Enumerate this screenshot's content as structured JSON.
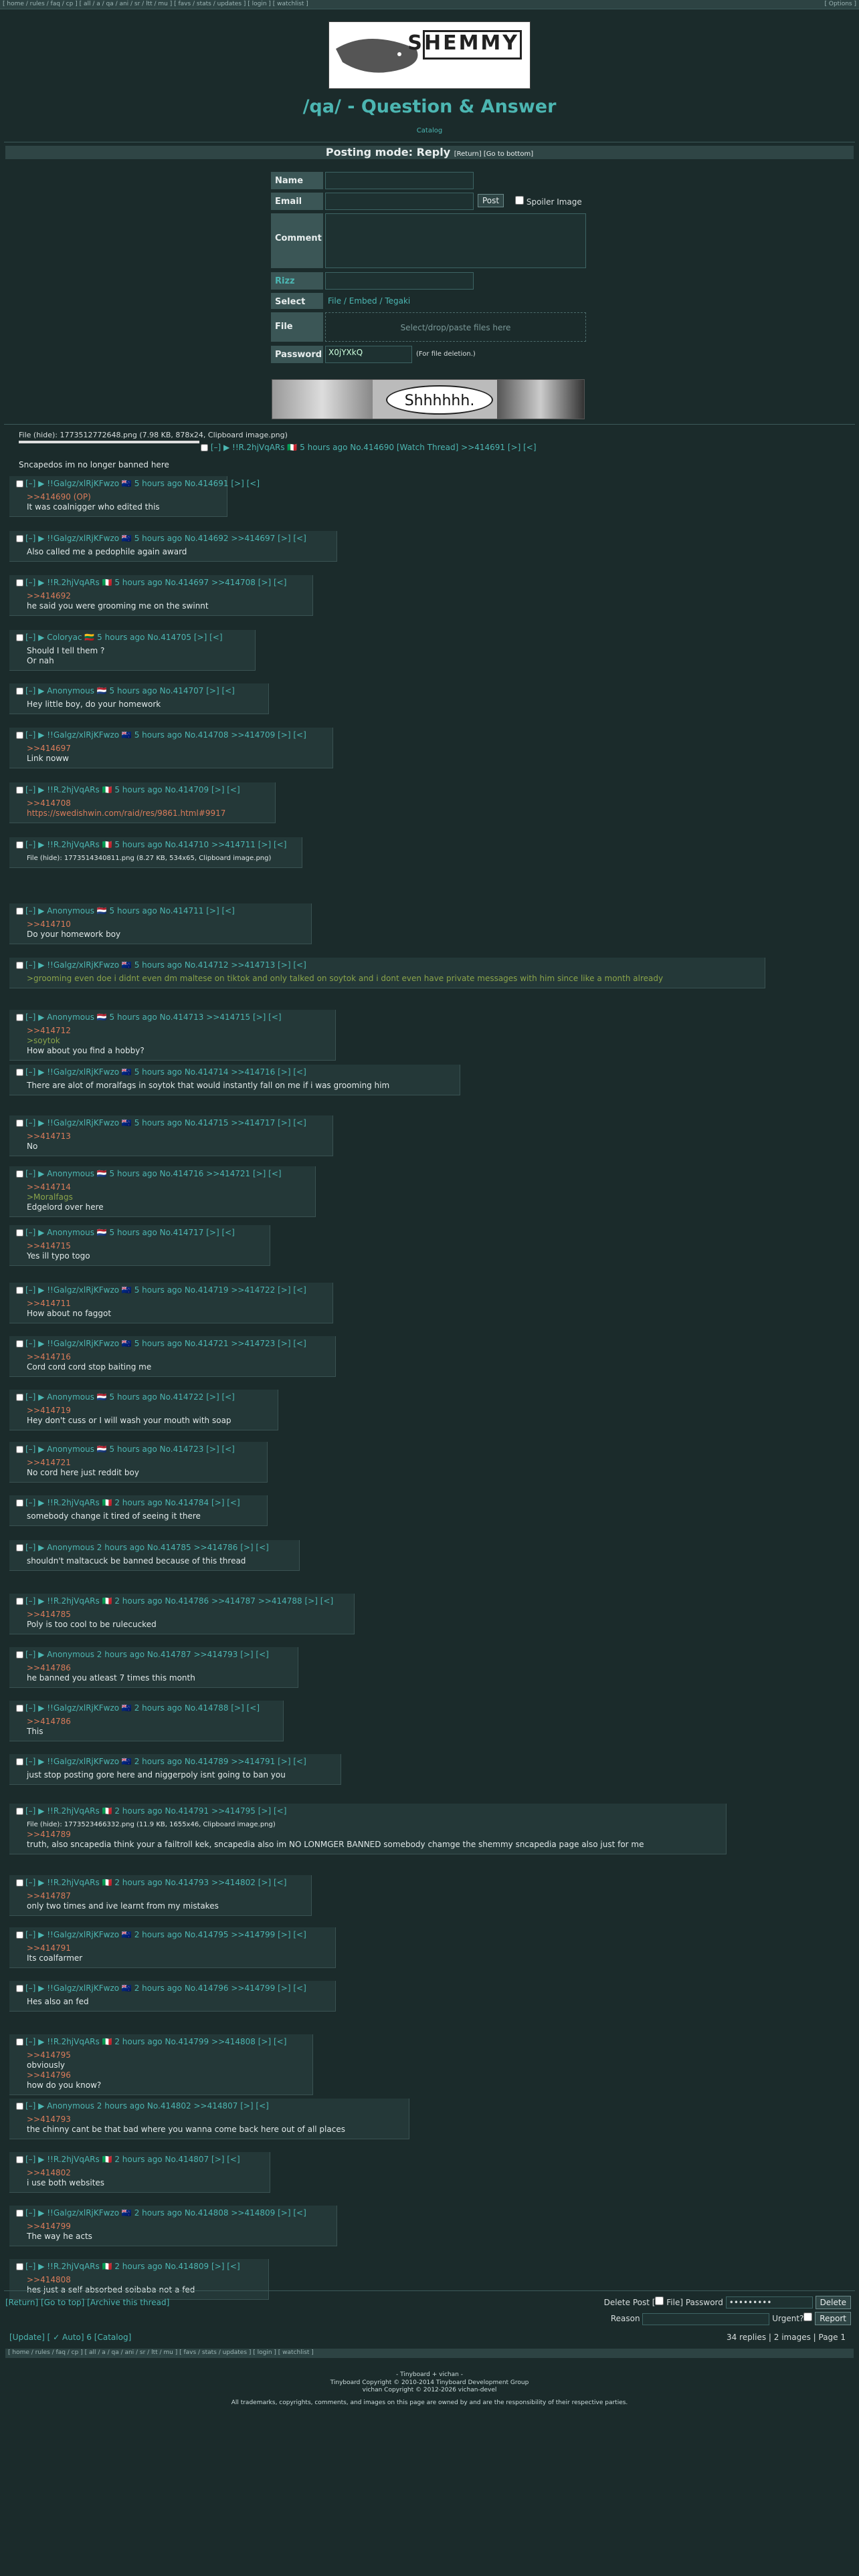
{
  "nav": {
    "left": "[ home / rules / faq / cp ] [ all / a / qa / ani / sr / ltt / mu ] [ favs / stats / updates ] [ login ] [ watchlist ]",
    "right": "[ Options ]"
  },
  "logo": {
    "text": "SHEMMY"
  },
  "board": {
    "title": "/qa/ - Question & Answer",
    "catalog": "Catalog"
  },
  "mode": {
    "label": "Posting mode: Reply",
    "links": "[Return] [Go to bottom]"
  },
  "form": {
    "name": "Name",
    "email": "Email",
    "post": "Post",
    "spoiler": "Spoiler Image",
    "comment": "Comment",
    "rizz": "Rizz",
    "select": "Select",
    "select_opts": "File / Embed / Tegaki",
    "file": "File",
    "drop": "Select/drop/paste files here",
    "password": "Password",
    "pw_val": "X0jYXkQ",
    "pw_note": "(For file deletion.)"
  },
  "banner": {
    "text": "Shhhhhh."
  },
  "op": {
    "file": "File (hide): 1773512772648.png (7.98 KB, 878x24, Clipboard image.png)",
    "head": "[–] ▶ !!R.2hjVqARs 🇮🇹 5 hours ago No.414690 [Watch Thread] >>414691 [>] [<]",
    "body": "Sncapedos im no longer banned here"
  },
  "posts": [
    {
      "h": "[–] ▶ !!Galgz/xlRjKFwzo 🇳🇿 5 hours ago No.414691 [>] [<]",
      "b": [
        ">>414690 (OP)",
        "It was coalnigger who edited this"
      ]
    },
    {
      "h": "[–] ▶ !!Galgz/xlRjKFwzo 🇳🇿 5 hours ago No.414692 >>414697 [>] [<]",
      "b": [
        "Also called me a pedophile again award"
      ]
    },
    {
      "h": "[–] ▶ !!R.2hjVqARs 🇮🇹 5 hours ago No.414697 >>414708 [>] [<]",
      "b": [
        ">>414692",
        "he said you were grooming me on the swinnt"
      ]
    },
    {
      "h": "[–] ▶ Coloryac 🇱🇹 5 hours ago No.414705 [>] [<]",
      "b": [
        "Should I tell them ?",
        "Or nah"
      ]
    },
    {
      "h": "[–] ▶ Anonymous 🇳🇱 5 hours ago No.414707 [>] [<]",
      "b": [
        "Hey little boy, do your homework"
      ]
    },
    {
      "h": "[–] ▶ !!Galgz/xlRjKFwzo 🇳🇿 5 hours ago No.414708 >>414709 [>] [<]",
      "b": [
        ">>414697",
        "Link noww"
      ]
    },
    {
      "h": "[–] ▶ !!R.2hjVqARs 🇮🇹 5 hours ago No.414709 [>] [<]",
      "b": [
        ">>414708",
        "https://swedishwin.com/raid/res/9861.html#9917"
      ]
    },
    {
      "h": "[–] ▶ !!R.2hjVqARs 🇮🇹 5 hours ago No.414710 >>414711 [>] [<]",
      "b": [
        "File (hide): 1773514340811.png (8.27 KB, 534x65, Clipboard image.png)"
      ]
    },
    {
      "h": "[–] ▶ Anonymous 🇳🇱 5 hours ago No.414711 [>] [<]",
      "b": [
        ">>414710",
        "Do your homework boy"
      ]
    },
    {
      "h": "[–] ▶ !!Galgz/xlRjKFwzo 🇳🇿 5 hours ago No.414712 >>414713 [>] [<]",
      "b": [
        ">grooming even doe i didnt even dm maltese on tiktok and only talked on soytok and i dont even have private messages with him since like a month already"
      ]
    },
    {
      "h": "[–] ▶ Anonymous 🇳🇱 5 hours ago No.414713 >>414715 [>] [<]",
      "b": [
        ">>414712",
        ">soytok",
        "How about you find a hobby?"
      ]
    },
    {
      "h": "[–] ▶ !!Galgz/xlRjKFwzo 🇳🇿 5 hours ago No.414714 >>414716 [>] [<]",
      "b": [
        "There are alot of moralfags in soytok that would instantly fall on me if i was grooming him"
      ]
    },
    {
      "h": "[–] ▶ !!Galgz/xlRjKFwzo 🇳🇿 5 hours ago No.414715 >>414717 [>] [<]",
      "b": [
        ">>414713",
        "No"
      ]
    },
    {
      "h": "[–] ▶ Anonymous 🇳🇱 5 hours ago No.414716 >>414721 [>] [<]",
      "b": [
        ">>414714",
        ">Moralfags",
        "Edgelord over here"
      ]
    },
    {
      "h": "[–] ▶ Anonymous 🇳🇱 5 hours ago No.414717 [>] [<]",
      "b": [
        ">>414715",
        "Yes ill typo togo"
      ]
    },
    {
      "h": "[–] ▶ !!Galgz/xlRjKFwzo 🇳🇿 5 hours ago No.414719 >>414722 [>] [<]",
      "b": [
        ">>414711",
        "How about no faggot"
      ]
    },
    {
      "h": "[–] ▶ !!Galgz/xlRjKFwzo 🇳🇿 5 hours ago No.414721 >>414723 [>] [<]",
      "b": [
        ">>414716",
        "Cord cord cord stop baiting me"
      ]
    },
    {
      "h": "[–] ▶ Anonymous 🇳🇱 5 hours ago No.414722 [>] [<]",
      "b": [
        ">>414719",
        "Hey don't cuss or I will wash your mouth with soap"
      ]
    },
    {
      "h": "[–] ▶ Anonymous 🇳🇱 5 hours ago No.414723 [>] [<]",
      "b": [
        ">>414721",
        "No cord here just reddit boy"
      ]
    },
    {
      "h": "[–] ▶ !!R.2hjVqARs 🇮🇹 2 hours ago No.414784 [>] [<]",
      "b": [
        "somebody change it tired of seeing it there"
      ]
    },
    {
      "h": "[–] ▶ Anonymous 2 hours ago No.414785 >>414786 [>] [<]",
      "b": [
        "shouldn't maltacuck be banned because of this thread"
      ]
    },
    {
      "h": "[–] ▶ !!R.2hjVqARs 🇮🇹 2 hours ago No.414786 >>414787 >>414788 [>] [<]",
      "b": [
        ">>414785",
        "Poly is too cool to be rulecucked"
      ]
    },
    {
      "h": "[–] ▶ Anonymous 2 hours ago No.414787 >>414793 [>] [<]",
      "b": [
        ">>414786",
        "he banned you atleast 7 times this month"
      ]
    },
    {
      "h": "[–] ▶ !!Galgz/xlRjKFwzo 🇳🇿 2 hours ago No.414788 [>] [<]",
      "b": [
        ">>414786",
        "This"
      ]
    },
    {
      "h": "[–] ▶ !!Galgz/xlRjKFwzo 🇳🇿 2 hours ago No.414789 >>414791 [>] [<]",
      "b": [
        "just stop posting gore here and niggerpoly isnt going to ban you"
      ]
    },
    {
      "h": "[–] ▶ !!R.2hjVqARs 🇮🇹 2 hours ago No.414791 >>414795 [>] [<]",
      "b": [
        "File (hide): 1773523466332.png (11.9 KB, 1655x46, Clipboard image.png)",
        ">>414789",
        "truth, also sncapedia think your a failtroll kek, sncapedia also im NO LONMGER BANNED somebody chamge the shemmy sncapedia page also just for me"
      ]
    },
    {
      "h": "[–] ▶ !!R.2hjVqARs 🇮🇹 2 hours ago No.414793 >>414802 [>] [<]",
      "b": [
        ">>414787",
        "only two times and ive learnt from my mistakes"
      ]
    },
    {
      "h": "[–] ▶ !!Galgz/xlRjKFwzo 🇳🇿 2 hours ago No.414795 >>414799 [>] [<]",
      "b": [
        ">>414791",
        "Its coalfarmer"
      ]
    },
    {
      "h": "[–] ▶ !!Galgz/xlRjKFwzo 🇳🇿 2 hours ago No.414796 >>414799 [>] [<]",
      "b": [
        "Hes also an fed"
      ]
    },
    {
      "h": "[–] ▶ !!R.2hjVqARs 🇮🇹 2 hours ago No.414799 >>414808 [>] [<]",
      "b": [
        ">>414795",
        "obviously",
        ">>414796",
        "how do you know?"
      ]
    },
    {
      "h": "[–] ▶ Anonymous 2 hours ago No.414802 >>414807 [>] [<]",
      "b": [
        ">>414793",
        "the chinny cant be that bad where you wanna come back here out of all places"
      ]
    },
    {
      "h": "[–] ▶ !!R.2hjVqARs 🇮🇹 2 hours ago No.414807 [>] [<]",
      "b": [
        ">>414802",
        "i use both websites"
      ]
    },
    {
      "h": "[–] ▶ !!Galgz/xlRjKFwzo 🇳🇿 2 hours ago No.414808 >>414809 [>] [<]",
      "b": [
        ">>414799",
        "The way he acts"
      ]
    },
    {
      "h": "[–] ▶ !!R.2hjVqARs 🇮🇹 2 hours ago No.414809 [>] [<]",
      "b": [
        ">>414808",
        "hes just a self absorbed soibaba not a fed"
      ]
    }
  ],
  "bottom": {
    "links": "[Return] [Go to top] [Archive this thread]",
    "delete_post": "Delete Post [",
    "file": " File] Password",
    "pw": "•••••••••",
    "delete": "Delete",
    "reason": "Reason",
    "urgent": "Urgent?",
    "report": "Report",
    "update": "[Update] [ ✓ Auto] 6 [Catalog]",
    "stats": "34 replies | 2 images | Page 1"
  },
  "footer": {
    "line1": "- Tinyboard + vichan -",
    "line2": "Tinyboard Copyright © 2010-2014 Tinyboard Development Group",
    "line3": "vichan Copyright © 2012-2026 vichan-devel",
    "line4": "All trademarks, copyrights, comments, and images on this page are owned by and are the responsibility of their respective parties."
  }
}
